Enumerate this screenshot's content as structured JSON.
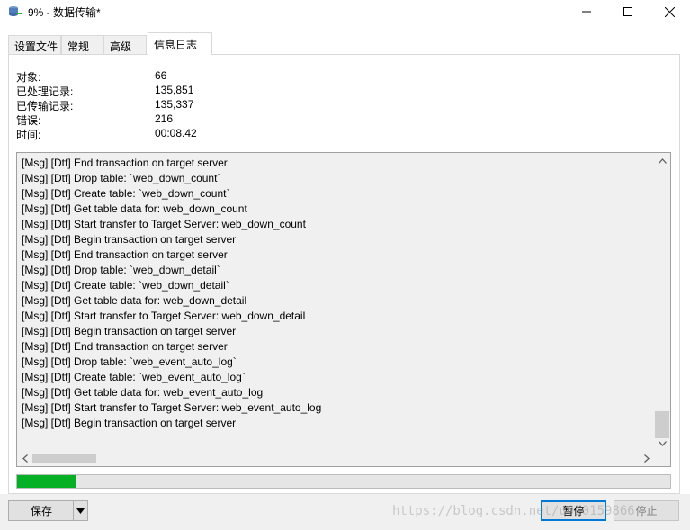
{
  "window": {
    "title": "9% - 数据传输*",
    "icon": "database-transfer-icon"
  },
  "tabs": [
    {
      "label": "设置文件",
      "active": false
    },
    {
      "label": "常规",
      "active": false
    },
    {
      "label": "高级",
      "active": false
    },
    {
      "label": "信息日志",
      "active": true
    }
  ],
  "stats": [
    {
      "label": "对象:",
      "value": "66"
    },
    {
      "label": "已处理记录:",
      "value": "135,851"
    },
    {
      "label": "已传输记录:",
      "value": "135,337"
    },
    {
      "label": "错误:",
      "value": "216"
    },
    {
      "label": "时间:",
      "value": "00:08.42"
    }
  ],
  "log": [
    "[Msg] [Dtf] End transaction on target server",
    "[Msg] [Dtf] Drop table: `web_down_count`",
    "[Msg] [Dtf] Create table: `web_down_count`",
    "[Msg] [Dtf] Get table data for: web_down_count",
    "[Msg] [Dtf] Start transfer to Target Server: web_down_count",
    "[Msg] [Dtf] Begin transaction on target server",
    "[Msg] [Dtf] End transaction on target server",
    "[Msg] [Dtf] Drop table: `web_down_detail`",
    "[Msg] [Dtf] Create table: `web_down_detail`",
    "[Msg] [Dtf] Get table data for: web_down_detail",
    "[Msg] [Dtf] Start transfer to Target Server: web_down_detail",
    "[Msg] [Dtf] Begin transaction on target server",
    "[Msg] [Dtf] End transaction on target server",
    "[Msg] [Dtf] Drop table: `web_event_auto_log`",
    "[Msg] [Dtf] Create table: `web_event_auto_log`",
    "[Msg] [Dtf] Get table data for: web_event_auto_log",
    "[Msg] [Dtf] Start transfer to Target Server: web_event_auto_log",
    "[Msg] [Dtf] Begin transaction on target server"
  ],
  "progress": {
    "fraction": 0.09,
    "color": "#06b025"
  },
  "buttons": {
    "save": "保存",
    "pause": "暂停",
    "stop": "停止"
  },
  "watermark": "https://blog.csdn.net/u010159866",
  "colors": {
    "accent": "#0078d7"
  }
}
